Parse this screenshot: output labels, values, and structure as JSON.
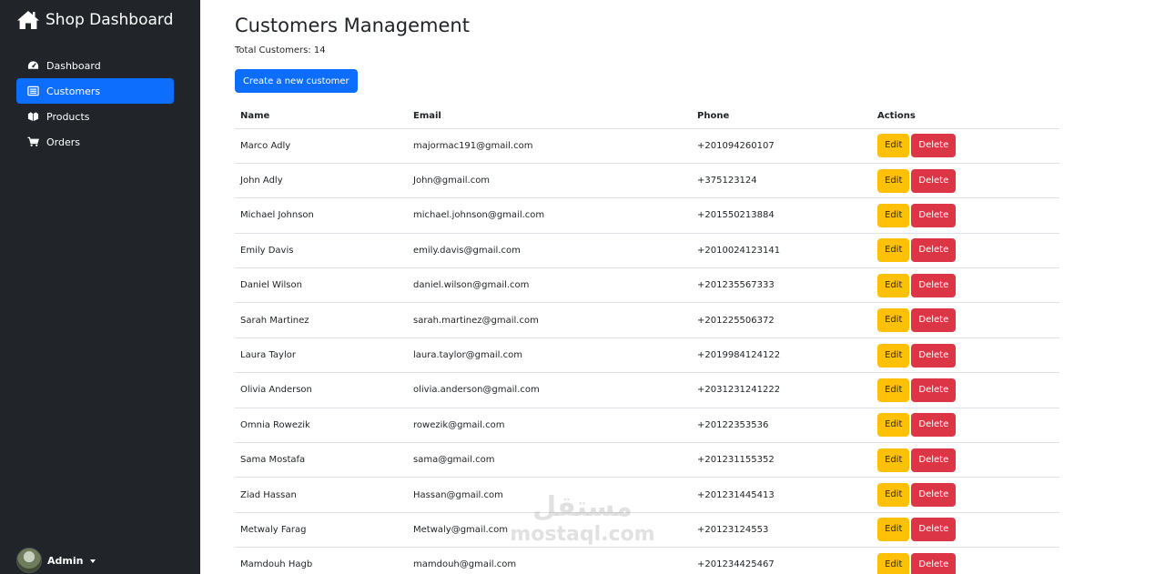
{
  "sidebar": {
    "brand": "Shop Dashboard",
    "brand_icon": "home-icon",
    "items": [
      {
        "label": "Dashboard",
        "icon": "speedometer-icon",
        "active": false
      },
      {
        "label": "Customers",
        "icon": "list-icon",
        "active": true
      },
      {
        "label": "Products",
        "icon": "boxes-icon",
        "active": false
      },
      {
        "label": "Orders",
        "icon": "cart-icon",
        "active": false
      }
    ],
    "user": {
      "name": "Admin"
    }
  },
  "main": {
    "title": "Customers Management",
    "total_label": "Total Customers:",
    "total_count": "14",
    "create_button": "Create a new customer",
    "table": {
      "headers": [
        "Name",
        "Email",
        "Phone",
        "Actions"
      ],
      "edit_label": "Edit",
      "delete_label": "Delete",
      "rows": [
        {
          "name": "Marco Adly",
          "email": "majormac191@gmail.com",
          "phone": "+201094260107"
        },
        {
          "name": "John Adly",
          "email": "John@gmail.com",
          "phone": "+375123124"
        },
        {
          "name": "Michael Johnson",
          "email": "michael.johnson@gmail.com",
          "phone": "+201550213884"
        },
        {
          "name": "Emily Davis",
          "email": "emily.davis@gmail.com",
          "phone": "+2010024123141"
        },
        {
          "name": "Daniel Wilson",
          "email": "daniel.wilson@gmail.com",
          "phone": "+201235567333"
        },
        {
          "name": "Sarah Martinez",
          "email": "sarah.martinez@gmail.com",
          "phone": "+201225506372"
        },
        {
          "name": "Laura Taylor",
          "email": "laura.taylor@gmail.com",
          "phone": "+2019984124122"
        },
        {
          "name": "Olivia Anderson",
          "email": "olivia.anderson@gmail.com",
          "phone": "+2031231241222"
        },
        {
          "name": "Omnia Rowezik",
          "email": "rowezik@gmail.com",
          "phone": "+20122353536"
        },
        {
          "name": "Sama Mostafa",
          "email": "sama@gmail.com",
          "phone": "+201231155352"
        },
        {
          "name": "Ziad Hassan",
          "email": "Hassan@gmail.com",
          "phone": "+201231445413"
        },
        {
          "name": "Metwaly Farag",
          "email": "Metwaly@gmail.com",
          "phone": "+20123124553"
        },
        {
          "name": "Mamdouh Hagb",
          "email": "mamdouh@gmail.com",
          "phone": "+201234425467"
        }
      ]
    }
  },
  "watermark": {
    "arabic": "مستقل",
    "latin": "mostaql.com"
  },
  "colors": {
    "sidebar_bg": "#212529",
    "primary": "#0d6efd",
    "warning": "#ffc107",
    "danger": "#dc3545"
  }
}
